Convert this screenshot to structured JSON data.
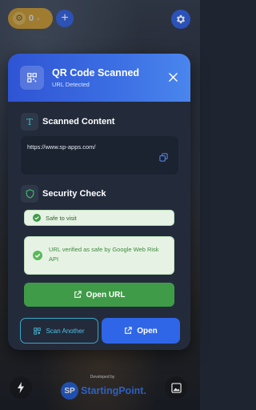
{
  "topbar": {
    "scan_count": "0"
  },
  "modal": {
    "title": "QR Code Scanned",
    "subtitle": "URL Detected",
    "content_section_title": "Scanned Content",
    "scanned_url": "https://www.sp-apps.com/",
    "security_section_title": "Security Check",
    "safe_badge": "Safe to visit",
    "verified_text": "URL verified as safe by Google Web Risk API",
    "open_url_label": "Open URL",
    "scan_another_label": "Scan Another",
    "open_label": "Open"
  },
  "footer": {
    "developed_by": "Developed by",
    "brand_initials": "SP",
    "brand_name": "StartingPoint."
  },
  "colors": {
    "accent_blue": "#2f66e8",
    "success_green": "#3f9b47",
    "cyan_outline": "#3aa6c6",
    "modal_bg": "#232b3b",
    "badge_gold": "#e3a21a"
  },
  "icons": [
    "qr-code-icon",
    "close-icon",
    "text-icon",
    "copy-icon",
    "shield-icon",
    "check-circle-icon",
    "external-link-icon",
    "scan-icon",
    "flash-icon",
    "gallery-icon",
    "settings-icon",
    "plus-icon",
    "gear-icon"
  ]
}
